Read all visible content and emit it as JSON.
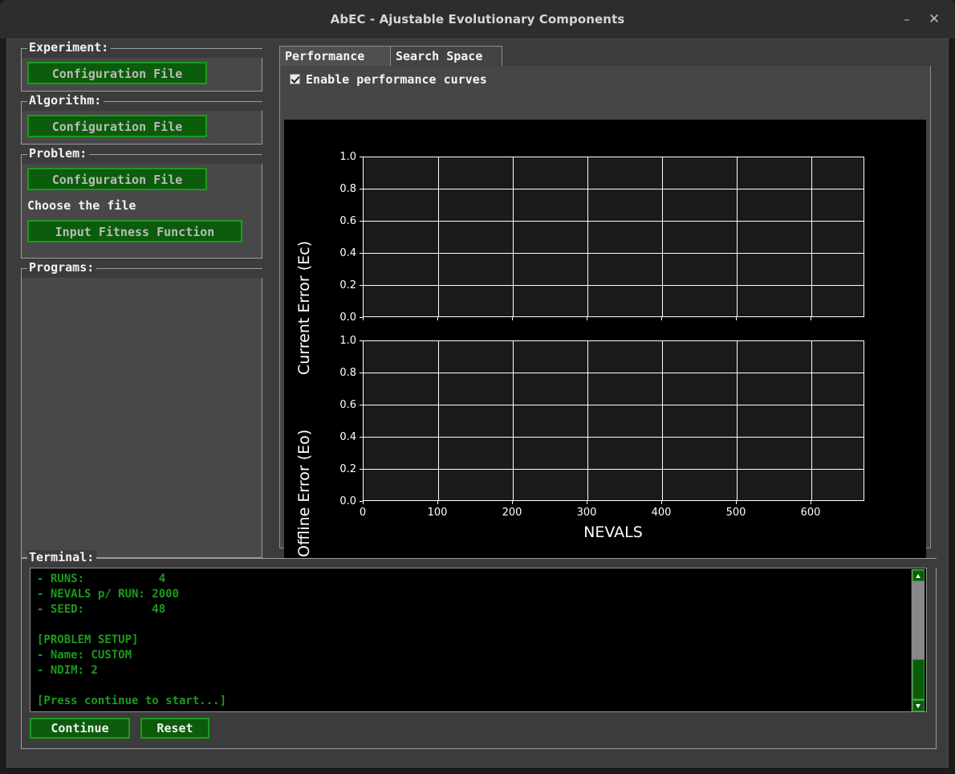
{
  "window": {
    "title": "AbEC - Ajustable Evolutionary Components",
    "minimize_icon": "minimize-icon",
    "minimize_glyph": "–",
    "close_icon": "close-icon",
    "close_glyph": "✕"
  },
  "colors": {
    "accent_green": "#1f9a1f",
    "button_fill": "#0b5c0b",
    "panel": "#484848",
    "app_bg": "#3c3c3c",
    "terminal_text": "#1d9a1d",
    "figure_bg": "#000000",
    "axes_bg": "#1a1a1a"
  },
  "sidebar": {
    "groups": [
      {
        "title": "Experiment:",
        "buttons": [
          {
            "label": "Configuration File",
            "style": "muted"
          }
        ]
      },
      {
        "title": "Algorithm:",
        "buttons": [
          {
            "label": "Configuration File",
            "style": "muted"
          }
        ]
      },
      {
        "title": "Problem:",
        "buttons": [
          {
            "label": "Configuration File",
            "style": "muted"
          },
          {
            "label": "Input Fitness Function",
            "style": "muted"
          }
        ],
        "static_label": "Choose the file"
      },
      {
        "title": "Programs:",
        "items": []
      }
    ]
  },
  "notebook": {
    "tabs": [
      {
        "label": "Performance",
        "active": true
      },
      {
        "label": "Search Space",
        "active": false
      }
    ],
    "checkbox": {
      "label": "Enable performance curves",
      "checked": true
    }
  },
  "chart_data": [
    {
      "type": "line",
      "title": "",
      "xlabel": "",
      "ylabel": "Current Error (Ec)",
      "xlim": [
        0,
        670
      ],
      "ylim": [
        0.0,
        1.0
      ],
      "xticks": [
        0,
        100,
        200,
        300,
        400,
        500,
        600
      ],
      "xtick_labels": [
        "0",
        "100",
        "200",
        "300",
        "400",
        "500",
        "600"
      ],
      "yticks": [
        0.0,
        0.2,
        0.4,
        0.6,
        0.8,
        1.0
      ],
      "ytick_labels": [
        "0.0",
        "0.2",
        "0.4",
        "0.6",
        "0.8",
        "1.0"
      ],
      "grid": true,
      "legend": null,
      "series": []
    },
    {
      "type": "line",
      "title": "",
      "xlabel": "NEVALS",
      "ylabel": "Offline Error (Eo)",
      "xlim": [
        0,
        670
      ],
      "ylim": [
        0.0,
        1.0
      ],
      "xticks": [
        0,
        100,
        200,
        300,
        400,
        500,
        600
      ],
      "xtick_labels": [
        "0",
        "100",
        "200",
        "300",
        "400",
        "500",
        "600"
      ],
      "yticks": [
        0.0,
        0.2,
        0.4,
        0.6,
        0.8,
        1.0
      ],
      "ytick_labels": [
        "0.0",
        "0.2",
        "0.4",
        "0.6",
        "0.8",
        "1.0"
      ],
      "grid": true,
      "legend": null,
      "series": []
    }
  ],
  "terminal": {
    "title": "Terminal:",
    "content": "- RUNS:           4\n- NEVALS p/ RUN: 2000\n- SEED:          48\n\n[PROBLEM SETUP]\n- Name: CUSTOM\n- NDIM: 2\n\n[Press continue to start...]",
    "scrollbar": {
      "up_arrow": "scroll-up-icon",
      "down_arrow": "scroll-down-icon"
    }
  },
  "footer": {
    "buttons": [
      {
        "label": "Continue",
        "style": "white"
      },
      {
        "label": "Reset",
        "style": "white"
      }
    ]
  }
}
